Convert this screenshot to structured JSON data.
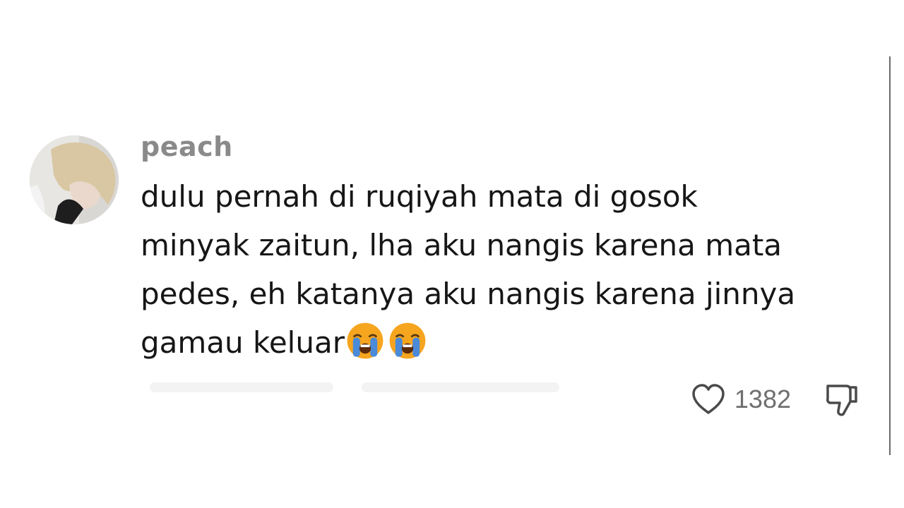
{
  "comment": {
    "username": "peach",
    "text_lines": [
      "dulu pernah di ruqiyah mata di gosok",
      "minyak zaitun, lha aku nangis karena mata",
      "pedes, eh katanya aku nangis karena jinnya",
      "gamau keluar"
    ],
    "emojis": [
      "loudly-crying-face",
      "loudly-crying-face"
    ],
    "like_count": "1382"
  },
  "icons": {
    "like": "heart-outline-icon",
    "dislike": "thumbs-down-outline-icon"
  },
  "colors": {
    "username": "#8a8a8a",
    "text": "#161616",
    "meta": "#6f6f6f",
    "emoji_face": "#f6a51f",
    "emoji_tears": "#4a8ad8"
  }
}
